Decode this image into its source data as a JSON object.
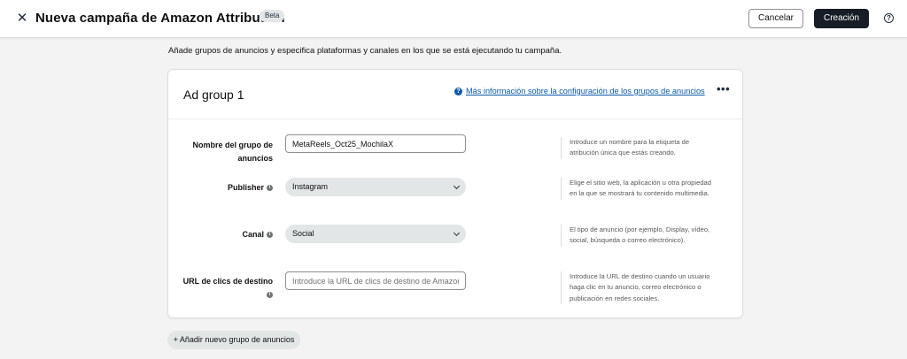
{
  "header": {
    "close_glyph": "✕",
    "title": "Nueva campaña de Amazon Attribution",
    "badge": "Beta",
    "cancel_label": "Cancelar",
    "create_label": "Creación",
    "help_glyph": "?"
  },
  "intro_text": "Añade grupos de anuncios y especifica plataformas y canales en los que se está ejecutando tu campaña.",
  "ad_group": {
    "title": "Ad group 1",
    "info_icon_glyph": "?",
    "info_link": "Más información sobre la configuración de los grupos de anuncios",
    "more_glyph": "•••",
    "fields": {
      "name": {
        "label_line1": "Nombre del grupo de",
        "label_line2": "anuncios",
        "value": "MetaReels_Oct25_MochilaX",
        "help": "Introduce un nombre para la etiqueta de atribución única que estás creando."
      },
      "publisher": {
        "label": "Publisher",
        "value": "Instagram",
        "help": "Elige el sitio web, la aplicación u otra propiedad en la que se mostrará tu contenido multimedia."
      },
      "channel": {
        "label": "Canal",
        "value": "Social",
        "help": "El tipo de anuncio (por ejemplo, Display, vídeo, social, búsqueda o correo electrónico)."
      },
      "click_url": {
        "label": "URL de clics de destino",
        "placeholder": "Introduce la URL de clics de destino de Amazon",
        "help": "Introduce la URL de destino cuando un usuario haga clic en tu anuncio, correo electrónico o publicación en redes sociales."
      }
    },
    "info_dot_glyph": "i"
  },
  "add_group_label": "+ Añadir nuevo grupo de anuncios",
  "colors": {
    "primary_button": "#161d26",
    "link": "#0a58a6",
    "select_bg": "#e3e6e6",
    "page_bg": "#f3f3f3"
  }
}
